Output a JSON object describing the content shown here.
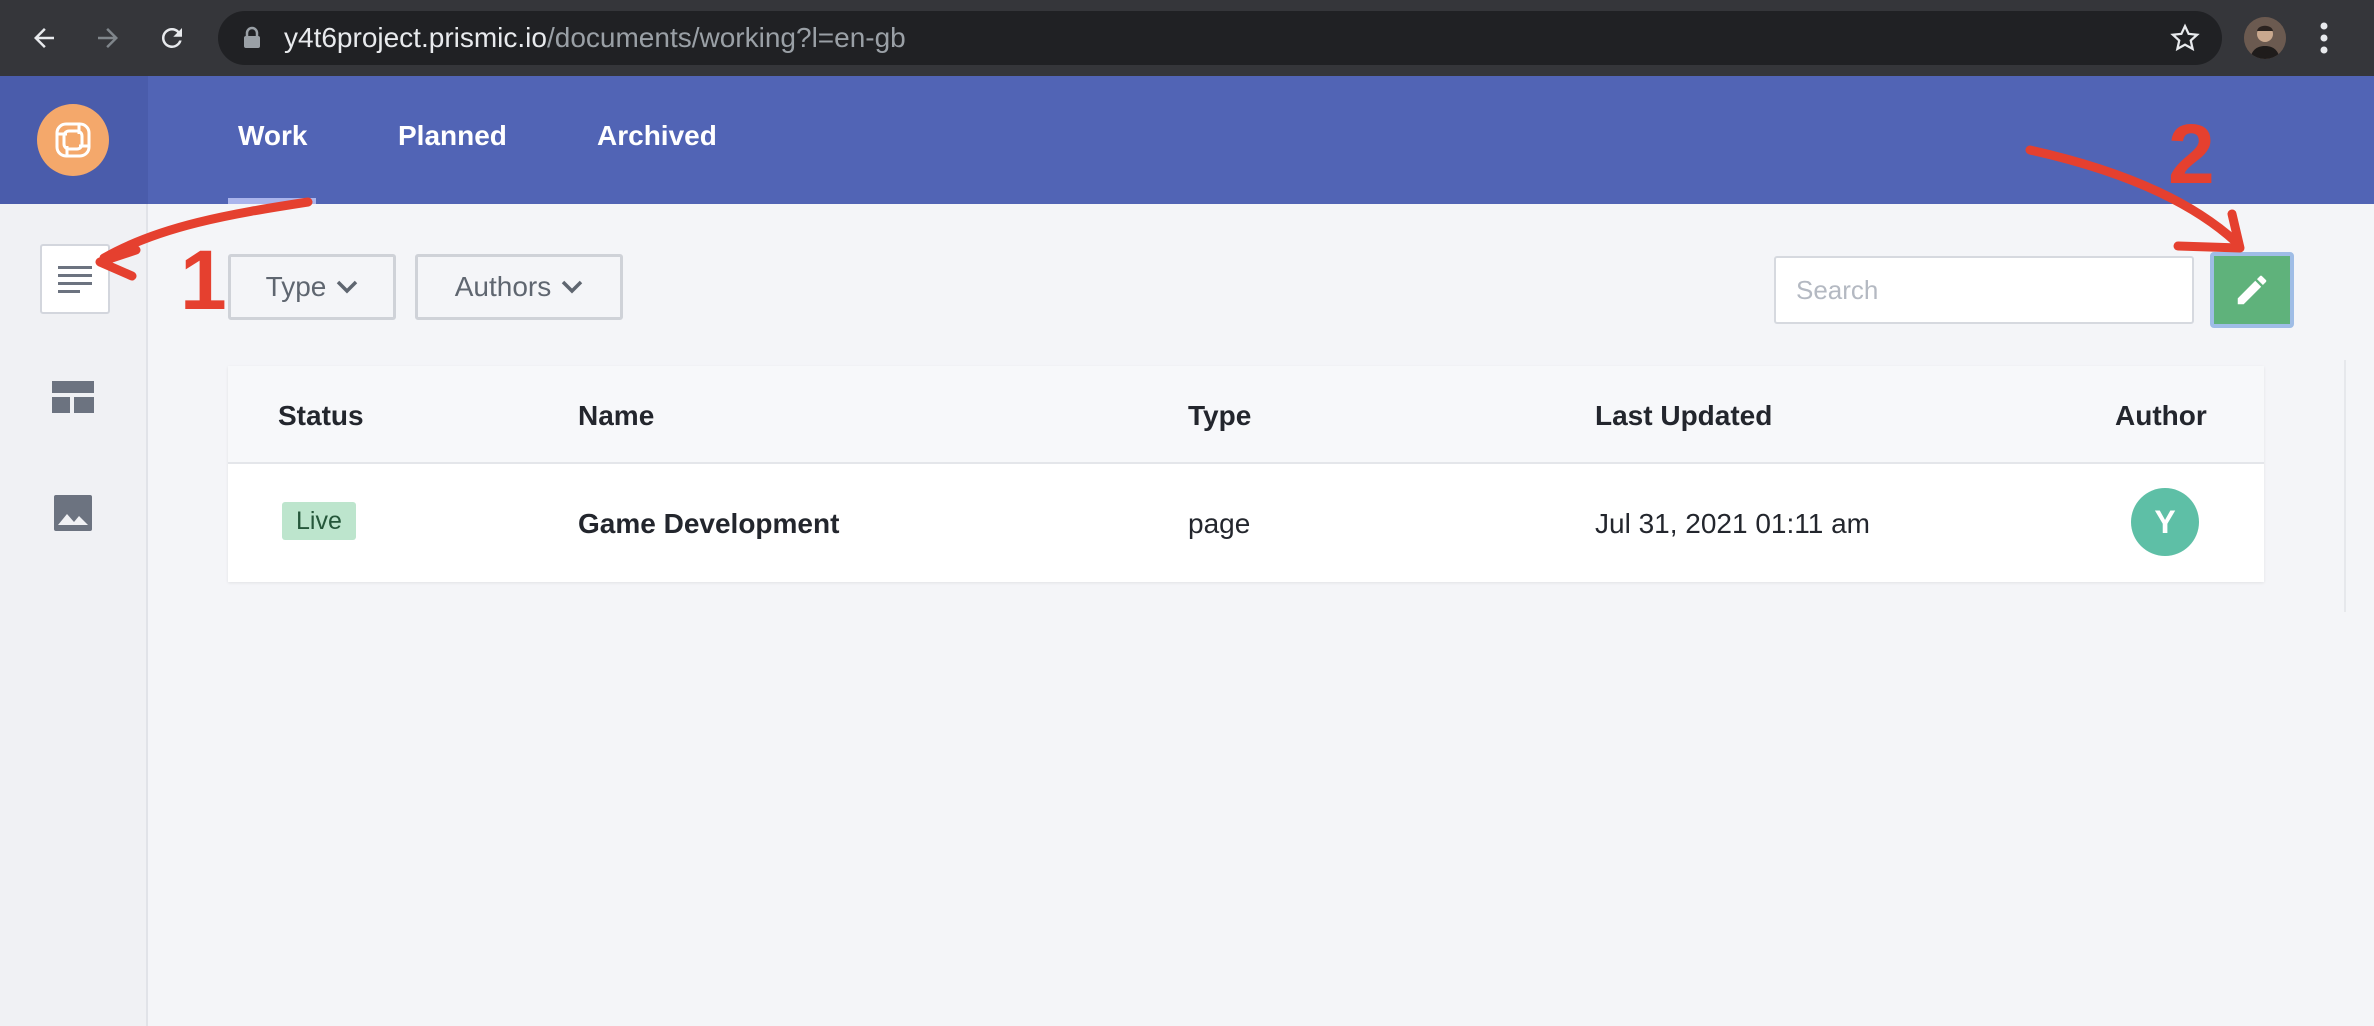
{
  "browser": {
    "url_host": "y4t6project.prismic.io",
    "url_path": "/documents/working?l=en-gb"
  },
  "header": {
    "tabs": [
      {
        "label": "Work",
        "active": true
      },
      {
        "label": "Planned",
        "active": false
      },
      {
        "label": "Archived",
        "active": false
      }
    ]
  },
  "sidebar": {
    "items": [
      {
        "icon": "document-list-icon",
        "active": true
      },
      {
        "icon": "layout-icon",
        "active": false
      },
      {
        "icon": "image-icon",
        "active": false
      }
    ]
  },
  "toolbar": {
    "type_filter_label": "Type",
    "authors_filter_label": "Authors",
    "search_placeholder": "Search",
    "new_document_icon": "pencil-icon"
  },
  "table": {
    "columns": [
      "Status",
      "Name",
      "Type",
      "Last Updated",
      "Author"
    ],
    "rows": [
      {
        "status": "Live",
        "name": "Game Development",
        "type": "page",
        "last_updated": "Jul 31, 2021 01:11 am",
        "author_initial": "Y"
      }
    ]
  },
  "annotations": {
    "label_1": "1",
    "label_2": "2",
    "color": "#e5402f"
  },
  "colors": {
    "header": "#5164b5",
    "logo": "#f4a86b",
    "new_button": "#5fb27b",
    "live_badge": "#bde5cd",
    "avatar": "#5ebfa6"
  }
}
